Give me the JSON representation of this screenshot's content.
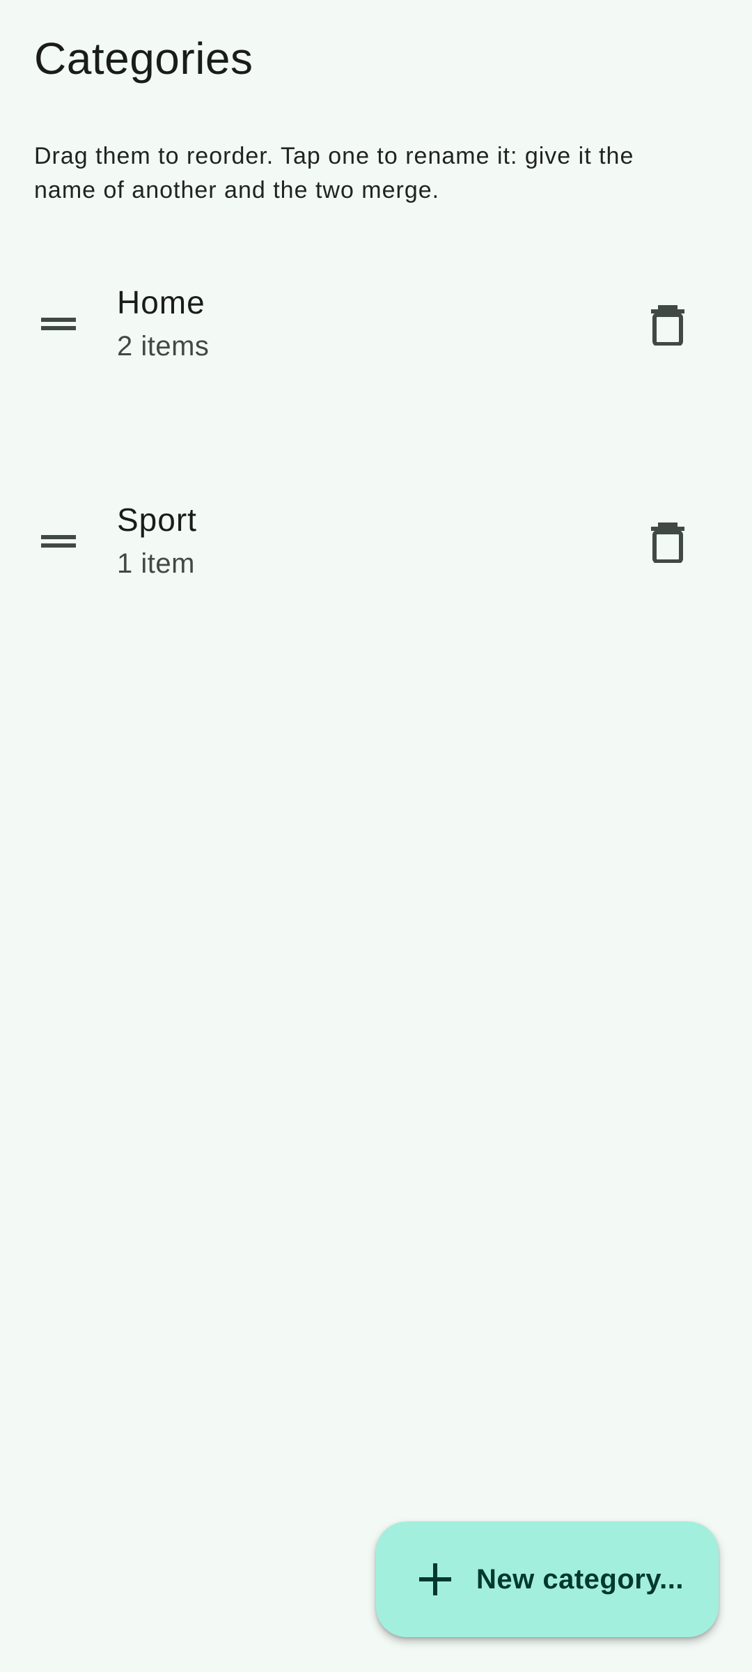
{
  "header": {
    "title": "Categories"
  },
  "hint": {
    "text": "Drag them to reorder. Tap one to rename it: give it the name of another and the two merge."
  },
  "categories": [
    {
      "name": "Home",
      "count": "2 items"
    },
    {
      "name": "Sport",
      "count": "1 item"
    }
  ],
  "icons": {
    "drag": "drag-handle-icon",
    "delete": "delete-icon",
    "add": "plus-icon"
  },
  "fab": {
    "label": "New category..."
  },
  "colors": {
    "background": "#f3f9f5",
    "fab_background": "#a2efdd",
    "fab_text": "#00382d",
    "icon": "#404944"
  }
}
